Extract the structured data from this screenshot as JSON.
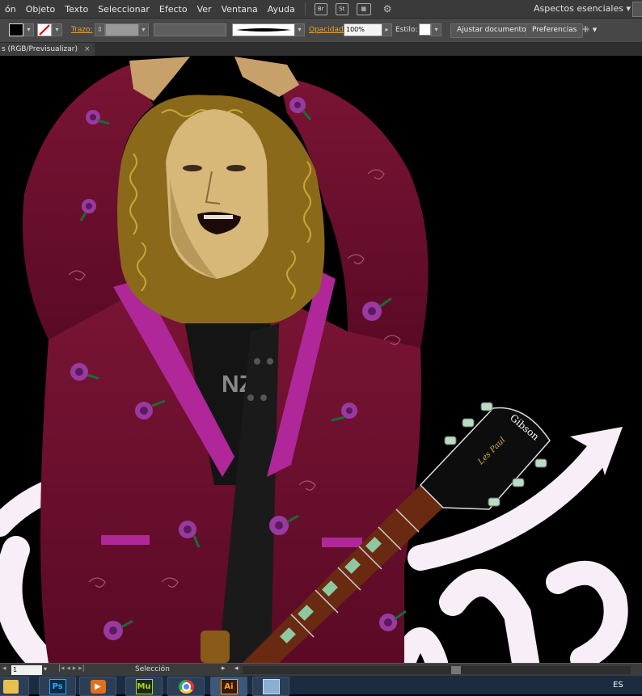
{
  "menu": {
    "items": [
      "ón",
      "Objeto",
      "Texto",
      "Seleccionar",
      "Efecto",
      "Ver",
      "Ventana",
      "Ayuda"
    ],
    "bridge_label": "Br",
    "stock_label": "St",
    "workspace": "Aspectos esenciales"
  },
  "control": {
    "stroke_label": "Trazo:",
    "opacity_label": "Opacidad:",
    "opacity_value": "100%",
    "style_label": "Estilo:",
    "adjust_doc": "Ajustar documento",
    "preferences": "Preferencias"
  },
  "document": {
    "tab_title": "s (RGB/Previsualizar)"
  },
  "artwork": {
    "guitar_brand": "Gibson",
    "guitar_model": "Les Paul",
    "shirt_text": "NZZ"
  },
  "status": {
    "zoom": "1",
    "tool": "Selección"
  },
  "taskbar": {
    "apps": [
      {
        "name": "Explorer",
        "label": ""
      },
      {
        "name": "Photoshop",
        "label": "Ps"
      },
      {
        "name": "Media Player",
        "label": ""
      },
      {
        "name": "Muse",
        "label": "Mu"
      },
      {
        "name": "Chrome",
        "label": ""
      },
      {
        "name": "Illustrator",
        "label": "Ai"
      },
      {
        "name": "Window",
        "label": ""
      }
    ],
    "language": "ES"
  },
  "colors": {
    "jacket": "#6e0f2e",
    "lapel": "#b0279a",
    "hair": "#8a6a1a",
    "skin": "#d8b878",
    "script": "#f8eef8"
  }
}
